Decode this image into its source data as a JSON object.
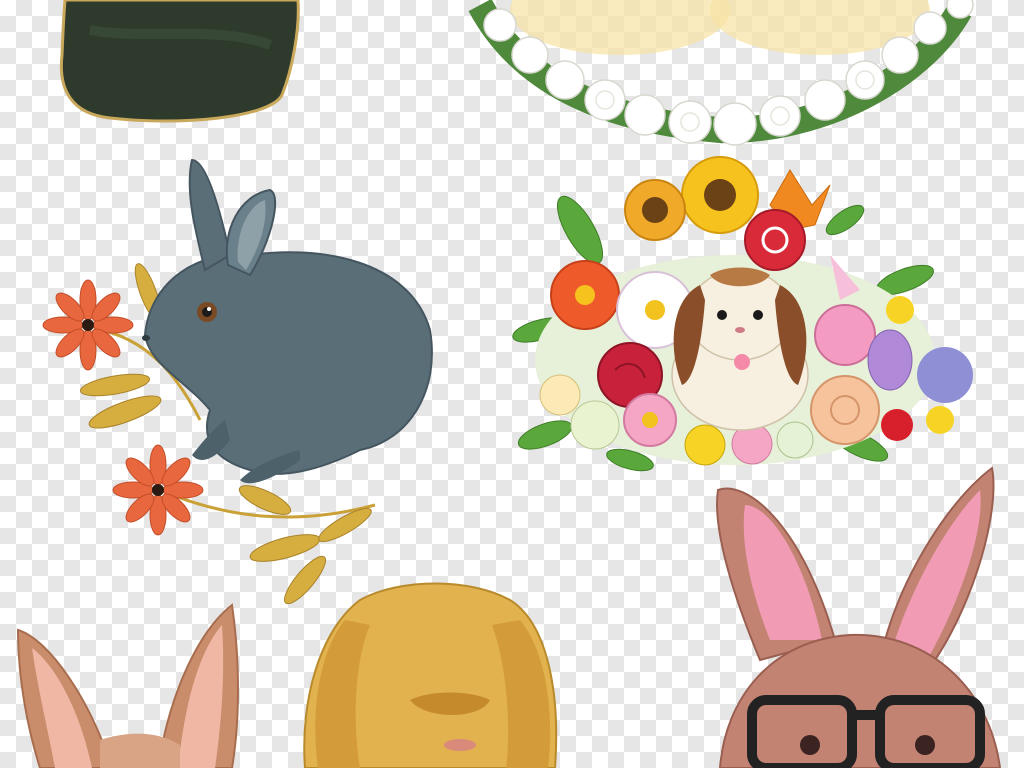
{
  "canvas": {
    "background": "transparency-checkerboard",
    "checker_colors": [
      "#ffffff",
      "#e6e6e6"
    ]
  },
  "artworks": [
    {
      "subject": "dark-green-watercolor-blob",
      "color": "#2e3b2c"
    },
    {
      "subject": "white-rose-wreath",
      "colors": [
        "#ffffff",
        "#4f8a3c",
        "#f6e3a3"
      ]
    },
    {
      "subject": "grey-blue-rabbit-with-orange-flowers",
      "colors": [
        "#5a6e78",
        "#e8673f",
        "#c9a137"
      ]
    },
    {
      "subject": "lop-rabbit-in-flower-bouquet",
      "colors": [
        "#f0b423",
        "#c8213b",
        "#f4a6c4",
        "#8a6f3f"
      ]
    },
    {
      "subject": "brown-rabbit-ears",
      "color": "#c98d6b"
    },
    {
      "subject": "golden-lop-rabbit",
      "color": "#e2b24e"
    },
    {
      "subject": "pink-rabbit-with-glasses",
      "colors": [
        "#c28372",
        "#f19bb4",
        "#222222"
      ]
    }
  ]
}
